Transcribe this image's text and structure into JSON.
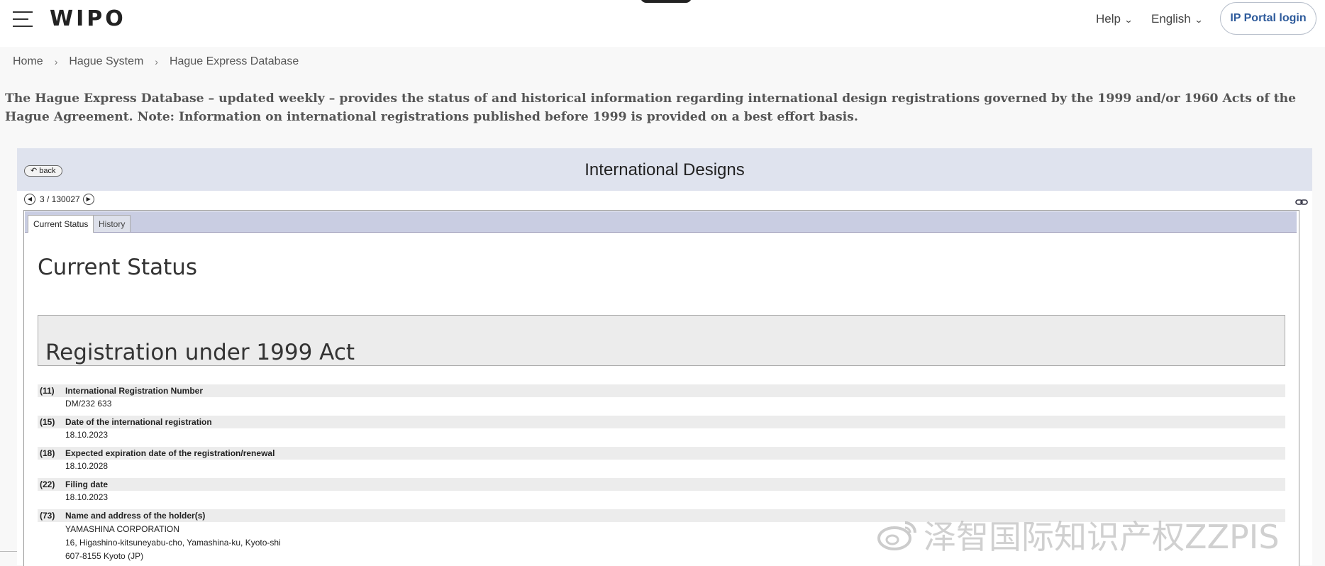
{
  "nav": {
    "logo": "WIPO",
    "help": "Help",
    "language": "English",
    "portal_login": "IP Portal login"
  },
  "breadcrumb": [
    "Home",
    "Hague System",
    "Hague Express Database"
  ],
  "intro": "The Hague Express Database – updated weekly – provides the status of and historical information regarding international design registrations governed by the 1999 and/or 1960 Acts of the Hague Agreement. Note: Information on international registrations published before 1999 is provided on a best effort basis.",
  "panel": {
    "back": "back",
    "title": "International Designs",
    "pager": "3 / 130027"
  },
  "tabs": [
    "Current Status",
    "History"
  ],
  "content": {
    "heading": "Current Status",
    "act_heading": "Registration under 1999 Act",
    "fields": [
      {
        "code": "(11)",
        "label": "International Registration Number",
        "value": "DM/232 633"
      },
      {
        "code": "(15)",
        "label": "Date of the international registration",
        "value": "18.10.2023"
      },
      {
        "code": "(18)",
        "label": "Expected expiration date of the registration/renewal",
        "value": "18.10.2028"
      },
      {
        "code": "(22)",
        "label": "Filing date",
        "value": "18.10.2023"
      },
      {
        "code": "(73)",
        "label": "Name and address of the holder(s)",
        "value_lines": [
          "YAMASHINA CORPORATION",
          "16, Higashino-kitsuneyabu-cho, Yamashina-ku, Kyoto-shi",
          "607-8155 Kyoto (JP)"
        ]
      }
    ]
  },
  "watermark": "泽智国际知识产权ZZPIS",
  "icons": {
    "menu": "hamburger-icon",
    "chevron": "chevron-down-icon",
    "back": "back-arrow-icon",
    "prev": "prev-arrow-icon",
    "next": "next-arrow-icon",
    "permalink": "link-icon",
    "watermark_logo": "weibo-icon"
  }
}
